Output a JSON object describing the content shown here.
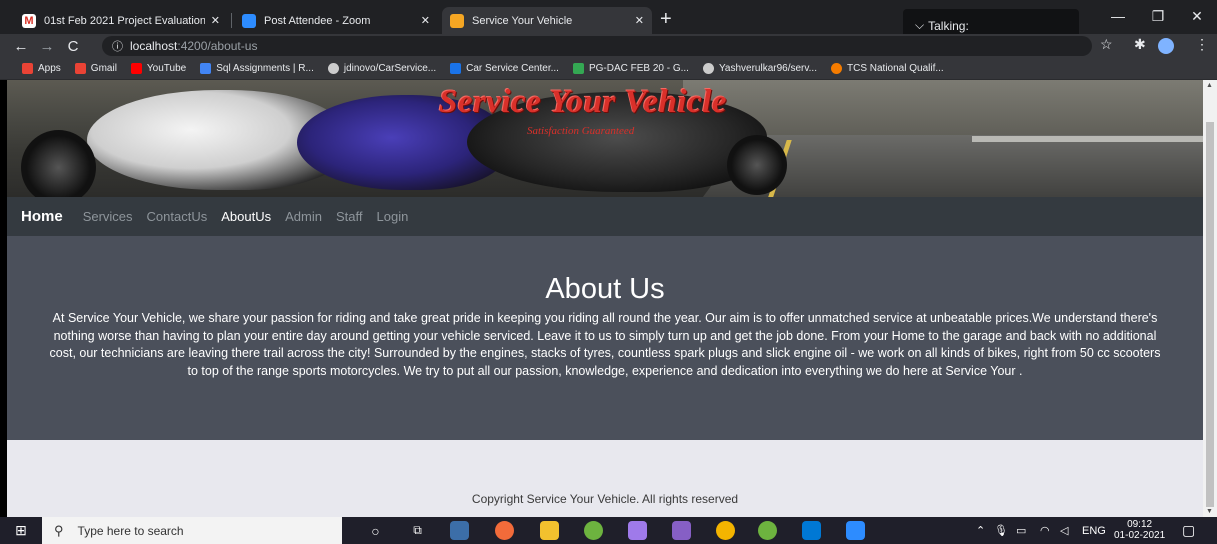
{
  "browser": {
    "tabs": [
      {
        "label": "01st Feb 2021 Project Evaluation",
        "color": "#d93025"
      },
      {
        "label": "Post Attendee - Zoom",
        "color": "#2d8cff"
      },
      {
        "label": "Service Your Vehicle",
        "color": "#f5a623"
      }
    ],
    "talking_label": "Talking:",
    "url_host": "localhost",
    "url_path": ":4200/about-us",
    "bookmarks": [
      {
        "label": "Apps",
        "color": "#ea4335"
      },
      {
        "label": "Gmail",
        "color": "#ea4335"
      },
      {
        "label": "YouTube",
        "color": "#ff0000"
      },
      {
        "label": "Sql Assignments | R...",
        "color": "#4285f4"
      },
      {
        "label": "jdinovo/CarService...",
        "color": "#cccccc"
      },
      {
        "label": "Car Service Center...",
        "color": "#1a73e8"
      },
      {
        "label": "PG-DAC FEB 20 - G...",
        "color": "#34a853"
      },
      {
        "label": "Yashverulkar96/serv...",
        "color": "#cccccc"
      },
      {
        "label": "TCS National Qualif...",
        "color": "#f57c00"
      }
    ]
  },
  "site": {
    "banner_title": "Service Your Vehicle",
    "banner_subtitle": "Satisfaction Guaranteed",
    "brand": "Home",
    "nav": [
      {
        "label": "Services",
        "active": false
      },
      {
        "label": "ContactUs",
        "active": false
      },
      {
        "label": "AboutUs",
        "active": true
      },
      {
        "label": "Admin",
        "active": false
      },
      {
        "label": "Staff",
        "active": false
      },
      {
        "label": "Login",
        "active": false
      }
    ],
    "about_heading": "About Us",
    "about_text": "At Service Your Vehicle, we share your passion for riding and take great pride in keeping you riding all round the year. Our aim is to offer unmatched service at unbeatable prices.We understand there's nothing worse than having to plan your entire day around getting your vehicle serviced. Leave it to us to simply turn up and get the job done. From your Home to the garage and back with no additional cost, our technicians are leaving there trail across the city! Surrounded by the engines, stacks of tyres, countless spark plugs and slick engine oil - we work on all kinds of bikes, right from 50 cc scooters to top of the range sports motorcycles. We try to put all our passion, knowledge, experience and dedication into everything we do here at Service Your .",
    "copyright": "Copyright Service Your Vehicle. All rights reserved"
  },
  "taskbar": {
    "search_placeholder": "Type here to search",
    "language": "ENG",
    "time": "09:12",
    "date": "01-02-2021"
  },
  "colors": {
    "navbar": "#343a40",
    "about_bg": "#4b505b",
    "title_red": "#d9302a"
  }
}
